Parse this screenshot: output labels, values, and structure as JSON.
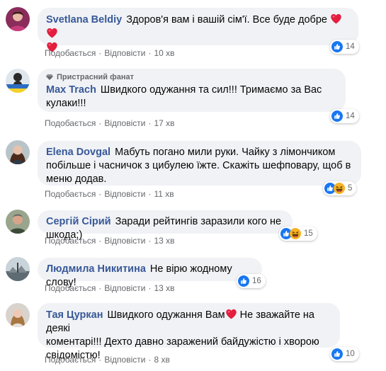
{
  "comments": [
    {
      "author": "Svetlana Beldiy",
      "text": "Здоров'я вам і вашій сім'ї. Все буде добре",
      "like_label": "Подобається",
      "reply_label": "Відповісти",
      "time": "10 хв",
      "reaction_count": "14",
      "reactions": [
        "like-icon"
      ]
    },
    {
      "badge": "Пристрасний фанат",
      "author": "Max Trach",
      "text": "Швидкого одужання та сил!!! Тримаємо за Вас",
      "text2": "кулаки!!!",
      "like_label": "Подобається",
      "reply_label": "Відповісти",
      "time": "17 хв",
      "reaction_count": "14",
      "reactions": [
        "like-icon"
      ]
    },
    {
      "author": "Elena Dovgal",
      "text": "Мабуть погано мили руки. Чайку з лімончиком",
      "text2": "побільше і часничок з цибулею їжте. Скажіть шефповару, щоб в",
      "text3": "меню додав.",
      "like_label": "Подобається",
      "reply_label": "Відповісти",
      "time": "11 хв",
      "reaction_count": "5",
      "reactions": [
        "like-icon",
        "laughing-emoji-icon"
      ]
    },
    {
      "author": "Сергій Сірий",
      "text": "Заради рейтингів заразили кого не шкода;)",
      "like_label": "Подобається",
      "reply_label": "Відповісти",
      "time": "13 хв",
      "reaction_count": "15",
      "reactions": [
        "like-icon",
        "laughing-emoji-icon"
      ]
    },
    {
      "author": "Людмила Никитина",
      "text": "Не вірю жодному слову!",
      "like_label": "Подобається",
      "reply_label": "Відповісти",
      "time": "13 хв",
      "reaction_count": "16",
      "reactions": [
        "like-icon"
      ]
    },
    {
      "author": "Тая Цуркан",
      "text": "Швидкого одужання Вам",
      "text2": "Не зважайте на деякі",
      "text3": "коментарі!!! Дехто давно заражений байдужістю і хворою",
      "text4": "свідомістю!",
      "like_label": "Подобається",
      "reply_label": "Відповісти",
      "time": "8 хв",
      "reaction_count": "10",
      "reactions": [
        "like-icon"
      ]
    }
  ],
  "colors": {
    "name": "#385898",
    "bubble": "#f0f2f5",
    "meta": "#65676b",
    "like_blue": "#1877f2",
    "heart_red": "#e41e3f"
  }
}
